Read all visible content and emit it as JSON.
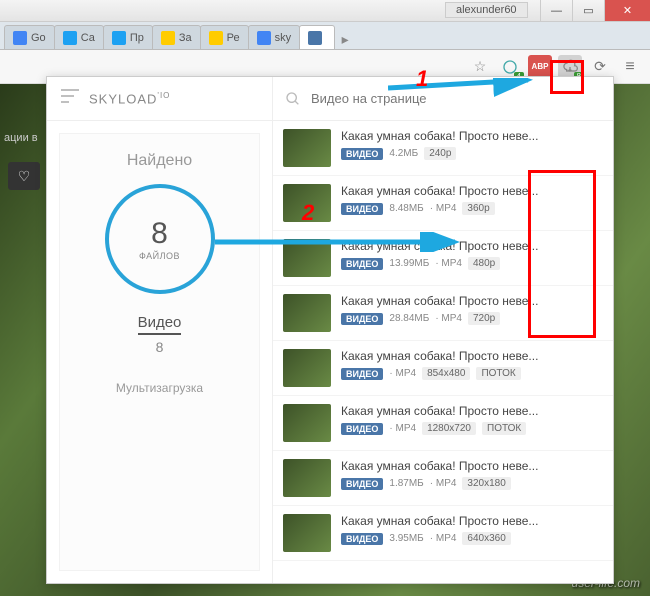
{
  "window": {
    "user": "alexunder60"
  },
  "tabs": [
    {
      "label": "Go",
      "fav": "g"
    },
    {
      "label": "Са",
      "fav": "m"
    },
    {
      "label": "Пр",
      "fav": "m"
    },
    {
      "label": "За",
      "fav": "y"
    },
    {
      "label": "Ре",
      "fav": "y"
    },
    {
      "label": "sky",
      "fav": "g"
    },
    {
      "label": "",
      "fav": "vk",
      "active": true
    }
  ],
  "toolbar": {
    "abp": "ABP",
    "skyload_badge_1": "4",
    "skyload_badge_2": "8"
  },
  "bg": {
    "text": "ации в",
    "watermark": "user-life.com"
  },
  "popup": {
    "brand": "SKYLOAD",
    "brand_sup": "'IO",
    "found_label": "Найдено",
    "circle_num": "8",
    "circle_lbl": "ФАЙЛОВ",
    "video_label": "Видео",
    "video_count": "8",
    "multi": "Мультизагрузка",
    "search_label": "Видео на странице",
    "vk_label": "ВИДЕО",
    "items": [
      {
        "title": "Какая умная собака! Просто неве...",
        "size": "4.2МБ",
        "fmt": "",
        "res": "240p"
      },
      {
        "title": "Какая умная собака! Просто неве...",
        "size": "8.48МБ",
        "fmt": "MP4",
        "res": "360p"
      },
      {
        "title": "Какая умная собака! Просто неве...",
        "size": "13.99МБ",
        "fmt": "MP4",
        "res": "480p"
      },
      {
        "title": "Какая умная собака! Просто неве...",
        "size": "28.84МБ",
        "fmt": "MP4",
        "res": "720p"
      },
      {
        "title": "Какая умная собака! Просто неве...",
        "size": "",
        "fmt": "MP4",
        "res": "854x480",
        "extra": "ПОТОК"
      },
      {
        "title": "Какая умная собака! Просто неве...",
        "size": "",
        "fmt": "MP4",
        "res": "1280x720",
        "extra": "ПОТОК"
      },
      {
        "title": "Какая умная собака! Просто неве...",
        "size": "1.87МБ",
        "fmt": "MP4",
        "res": "320x180"
      },
      {
        "title": "Какая умная собака! Просто неве...",
        "size": "3.95МБ",
        "fmt": "MP4",
        "res": "640x360"
      }
    ]
  },
  "annotations": {
    "n1": "1",
    "n2": "2"
  }
}
